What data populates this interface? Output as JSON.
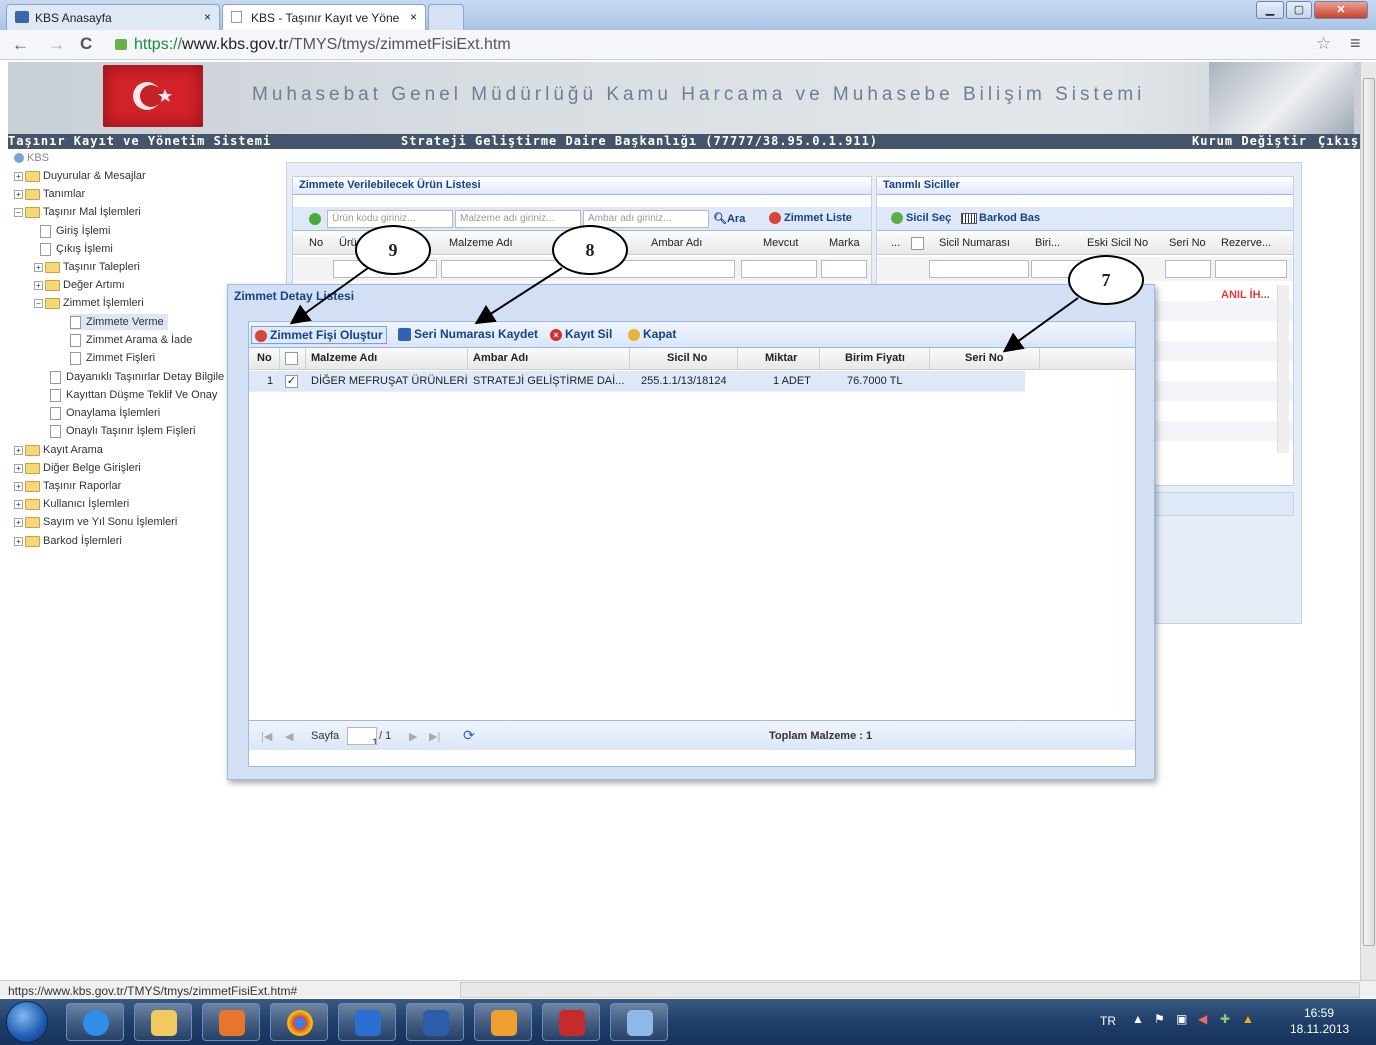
{
  "browser": {
    "tabs": [
      {
        "label": "KBS Anasayfa"
      },
      {
        "label": "KBS - Taşınır Kayıt ve Yöne"
      }
    ],
    "url_scheme": "https://",
    "url_host": "www.kbs.gov.tr",
    "url_path": "/TMYS/tmys/zimmetFisiExt.htm",
    "status_url": "https://www.kbs.gov.tr/TMYS/tmys/zimmetFisiExt.htm#"
  },
  "header": {
    "banner_title": "Muhasebat Genel Müdürlüğü Kamu Harcama ve Muhasebe Bilişim Sistemi",
    "app_name": "Taşınır Kayıt ve Yönetim Sistemi",
    "unit": "Strateji Geliştirme Daire Başkanlığı (77777/38.95.0.1.911)",
    "change_org": "Kurum Değiştir",
    "logout": "Çıkış"
  },
  "tree": {
    "root": "KBS",
    "items": [
      {
        "label": "Duyurular & Mesajlar"
      },
      {
        "label": "Tanımlar"
      },
      {
        "label": "Taşınır Mal İşlemleri"
      },
      {
        "label": "Giriş İşlemi"
      },
      {
        "label": "Çıkış İşlemi"
      },
      {
        "label": "Taşınır Talepleri"
      },
      {
        "label": "Değer Artımı"
      },
      {
        "label": "Zimmet İşlemleri"
      },
      {
        "label": "Zimmete Verme"
      },
      {
        "label": "Zimmet Arama & İade"
      },
      {
        "label": "Zimmet Fişleri"
      },
      {
        "label": "Dayanıklı Taşınırlar Detay Bilgile"
      },
      {
        "label": "Kayıttan Düşme Teklif Ve Onay"
      },
      {
        "label": "Onaylama İşlemleri"
      },
      {
        "label": "Onaylı Taşınır İşlem Fişleri"
      },
      {
        "label": "Kayıt Arama"
      },
      {
        "label": "Diğer Belge Girişleri"
      },
      {
        "label": "Taşınır Raporlar"
      },
      {
        "label": "Kullanıcı İşlemleri"
      },
      {
        "label": "Sayım ve Yıl Sonu İşlemleri"
      },
      {
        "label": "Barkod İşlemleri"
      }
    ]
  },
  "product_panel": {
    "title": "Zimmete Verilebilecek Ürün Listesi",
    "search_code_placeholder": "Ürün kodu giriniz...",
    "search_material_placeholder": "Malzeme adı giriniz...",
    "search_depot_placeholder": "Ambar adı giriniz...",
    "search_button": "Ara",
    "zimmet_list_button": "Zimmet Liste",
    "columns": [
      "No",
      "Ürü",
      "Malzeme Adı",
      "Ambar Adı",
      "Mevcut",
      "Marka"
    ]
  },
  "sicil_panel": {
    "title": "Tanımlı Siciller",
    "select_button": "Sicil Seç",
    "barcode_button": "Barkod Bas",
    "columns": [
      "...",
      "Sicil Numarası",
      "Biri...",
      "Eski Sicil No",
      "Seri No",
      "Rezerve..."
    ],
    "row_value": "ANIL İH..."
  },
  "modal": {
    "title": "Zimmet Detay Listesi",
    "toolbar": {
      "create": "Zimmet Fişi Oluştur",
      "save_serial": "Seri Numarası Kaydet",
      "delete": "Kayıt Sil",
      "close": "Kapat"
    },
    "columns": [
      "No",
      "Malzeme Adı",
      "Ambar Adı",
      "Sicil No",
      "Miktar",
      "Birim Fiyatı",
      "Seri No"
    ],
    "rows": [
      {
        "no": "1",
        "checked": true,
        "material": "DİĞER MEFRUŞAT ÜRÜNLERİ",
        "depot": "STRATEJİ GELİŞTİRME DAİ...",
        "sicil": "255.1.1/13/18124",
        "qty": "1 ADET",
        "price": "76.7000 TL",
        "serial": ""
      }
    ],
    "pager": {
      "page_label": "Sayfa",
      "page_value": "1",
      "page_total": "/ 1",
      "total_label": "Toplam Malzeme : 1"
    }
  },
  "callouts": [
    "9",
    "8",
    "7"
  ],
  "taskbar": {
    "lang": "TR",
    "time": "16:59",
    "date": "18.11.2013"
  },
  "colors": {
    "header_bar": "#44556b",
    "panel_title": "#15428b",
    "row_selected": "#dfe8f6",
    "flag_red": "#d2232a",
    "reserved_text": "#e23c3c"
  }
}
